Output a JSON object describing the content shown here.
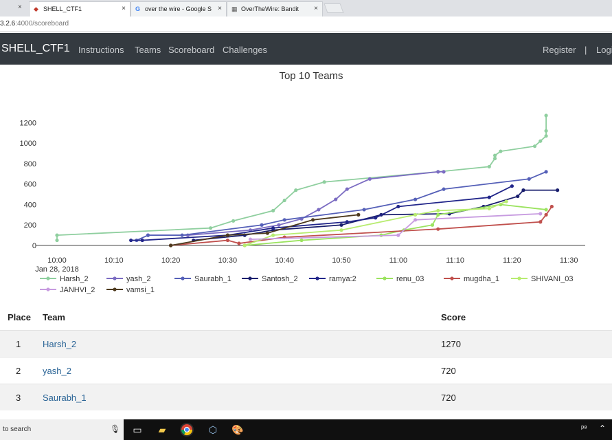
{
  "browser": {
    "tabs": [
      {
        "label": "SHELL_CTF1",
        "icon": "ctf-favicon-icon"
      },
      {
        "label": "over the wire - Google S",
        "icon": "google-icon"
      },
      {
        "label": "OverTheWire: Bandit",
        "icon": "overthewire-icon"
      }
    ],
    "url_host": "3.2.6",
    "url_rest": ":4000/scoreboard"
  },
  "nav": {
    "brand": "SHELL_CTF1",
    "links": [
      "Instructions",
      "Teams",
      "Scoreboard",
      "Challenges"
    ],
    "right": [
      "Register",
      "|",
      "Logi"
    ]
  },
  "chart_data": {
    "type": "line",
    "title": "Top 10 Teams",
    "x_ticks": [
      "10:00",
      "10:10",
      "10:20",
      "10:30",
      "10:40",
      "10:50",
      "11:00",
      "11:10",
      "11:20",
      "11:30"
    ],
    "x_sublabel": "Jan 28, 2018",
    "y_ticks": [
      0,
      200,
      400,
      600,
      800,
      1000,
      1200
    ],
    "ylim": [
      0,
      1300
    ],
    "legend_position": "bottom",
    "series": [
      {
        "name": "Harsh_2",
        "color": "#8fcf9f",
        "points": [
          [
            "10:00",
            50
          ],
          [
            "10:00",
            100
          ],
          [
            "10:27",
            170
          ],
          [
            "10:31",
            240
          ],
          [
            "10:38",
            340
          ],
          [
            "10:40",
            440
          ],
          [
            "10:42",
            540
          ],
          [
            "10:47",
            620
          ],
          [
            "11:07",
            720
          ],
          [
            "11:16",
            770
          ],
          [
            "11:17",
            850
          ],
          [
            "11:17",
            880
          ],
          [
            "11:18",
            920
          ],
          [
            "11:24",
            970
          ],
          [
            "11:25",
            1020
          ],
          [
            "11:26",
            1070
          ],
          [
            "11:26",
            1120
          ],
          [
            "11:26",
            1270
          ]
        ]
      },
      {
        "name": "yash_2",
        "color": "#7b6cc2",
        "points": [
          [
            "10:16",
            100
          ],
          [
            "10:23",
            100
          ],
          [
            "10:34",
            150
          ],
          [
            "10:39",
            200
          ],
          [
            "10:43",
            260
          ],
          [
            "10:46",
            350
          ],
          [
            "10:49",
            450
          ],
          [
            "10:51",
            550
          ],
          [
            "10:55",
            650
          ],
          [
            "11:07",
            720
          ],
          [
            "11:08",
            720
          ]
        ]
      },
      {
        "name": "Saurabh_1",
        "color": "#5560b8",
        "points": [
          [
            "10:14",
            50
          ],
          [
            "10:16",
            100
          ],
          [
            "10:22",
            100
          ],
          [
            "10:36",
            200
          ],
          [
            "10:40",
            250
          ],
          [
            "10:54",
            350
          ],
          [
            "11:03",
            450
          ],
          [
            "11:08",
            550
          ],
          [
            "11:23",
            650
          ],
          [
            "11:26",
            720
          ]
        ]
      },
      {
        "name": "Santosh_2",
        "color": "#1a1f6e",
        "points": [
          [
            "10:24",
            50
          ],
          [
            "10:33",
            100
          ],
          [
            "10:38",
            150
          ],
          [
            "10:50",
            200
          ],
          [
            "10:57",
            300
          ],
          [
            "11:09",
            310
          ],
          [
            "11:15",
            380
          ],
          [
            "11:21",
            480
          ],
          [
            "11:22",
            540
          ],
          [
            "11:28",
            540
          ]
        ]
      },
      {
        "name": "ramya:2",
        "color": "#22268a",
        "points": [
          [
            "10:13",
            50
          ],
          [
            "10:15",
            50
          ],
          [
            "10:30",
            100
          ],
          [
            "10:38",
            170
          ],
          [
            "10:51",
            230
          ],
          [
            "10:56",
            270
          ],
          [
            "11:00",
            380
          ],
          [
            "11:16",
            470
          ],
          [
            "11:20",
            580
          ]
        ]
      },
      {
        "name": "renu_03",
        "color": "#9be35f",
        "points": [
          [
            "10:33",
            0
          ],
          [
            "10:43",
            50
          ],
          [
            "10:57",
            100
          ],
          [
            "11:01",
            150
          ],
          [
            "11:06",
            200
          ],
          [
            "11:07",
            300
          ],
          [
            "11:18",
            400
          ],
          [
            "11:26",
            350
          ]
        ]
      },
      {
        "name": "mugdha_1",
        "color": "#c0504d",
        "points": [
          [
            "10:20",
            0
          ],
          [
            "10:30",
            50
          ],
          [
            "10:32",
            20
          ],
          [
            "10:40",
            80
          ],
          [
            "11:07",
            160
          ],
          [
            "11:25",
            230
          ],
          [
            "11:26",
            300
          ],
          [
            "11:27",
            380
          ]
        ]
      },
      {
        "name": "SHIVANI_03",
        "color": "#b8ec70",
        "points": [
          [
            "10:33",
            0
          ],
          [
            "10:38",
            100
          ],
          [
            "10:50",
            150
          ],
          [
            "11:03",
            300
          ],
          [
            "11:07",
            340
          ],
          [
            "11:16",
            360
          ],
          [
            "11:19",
            430
          ]
        ]
      },
      {
        "name": "JANHVI_2",
        "color": "#c79be0",
        "points": [
          [
            "10:34",
            60
          ],
          [
            "11:00",
            100
          ],
          [
            "11:03",
            250
          ],
          [
            "11:25",
            310
          ]
        ]
      },
      {
        "name": "vamsi_1",
        "color": "#4d3a1e",
        "points": [
          [
            "10:20",
            0
          ],
          [
            "10:30",
            100
          ],
          [
            "10:37",
            120
          ],
          [
            "10:45",
            250
          ],
          [
            "10:53",
            300
          ]
        ]
      }
    ]
  },
  "table": {
    "headers": [
      "Place",
      "Team",
      "Score"
    ],
    "rows": [
      {
        "place": "1",
        "team": "Harsh_2",
        "score": "1270"
      },
      {
        "place": "2",
        "team": "yash_2",
        "score": "720"
      },
      {
        "place": "3",
        "team": "Saurabh_1",
        "score": "720"
      }
    ]
  },
  "taskbar": {
    "search_text": "to search",
    "apps": [
      "microphone-icon",
      "task-view-icon",
      "file-explorer-icon",
      "chrome-icon",
      "virtualbox-icon",
      "paint-icon"
    ]
  }
}
